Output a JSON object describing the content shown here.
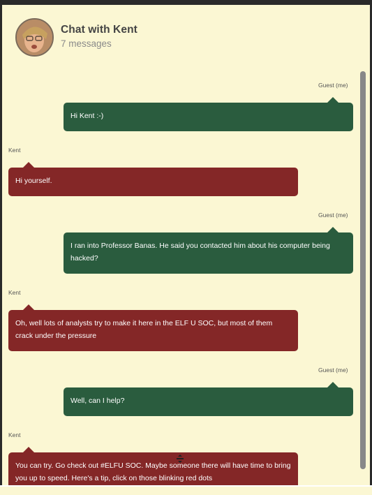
{
  "header": {
    "title": "Chat with Kent",
    "subtitle": "7 messages",
    "avatar_icon": "avatar-kent"
  },
  "messages": [
    {
      "sender": "Guest (me)",
      "text": "Hi Kent :-)",
      "from": "me"
    },
    {
      "sender": "Kent",
      "text": "Hi yourself.",
      "from": "kent"
    },
    {
      "sender": "Guest (me)",
      "text": "I ran into Professor Banas. He said you contacted him about his computer being hacked?",
      "from": "me"
    },
    {
      "sender": "Kent",
      "text": "Oh, well lots of analysts try to make it here in the ELF U SOC, but most of them crack under the pressure",
      "from": "kent"
    },
    {
      "sender": "Guest (me)",
      "text": "Well, can I help?",
      "from": "me"
    },
    {
      "sender": "Kent",
      "text": "You can try. Go check out #ELFU SOC. Maybe someone there will have time to bring you up to speed. Here's a tip, click on those blinking red dots",
      "from": "kent"
    }
  ],
  "colors": {
    "background": "#fbf7d3",
    "me_bubble": "#2a5c3e",
    "kent_bubble": "#842727"
  }
}
